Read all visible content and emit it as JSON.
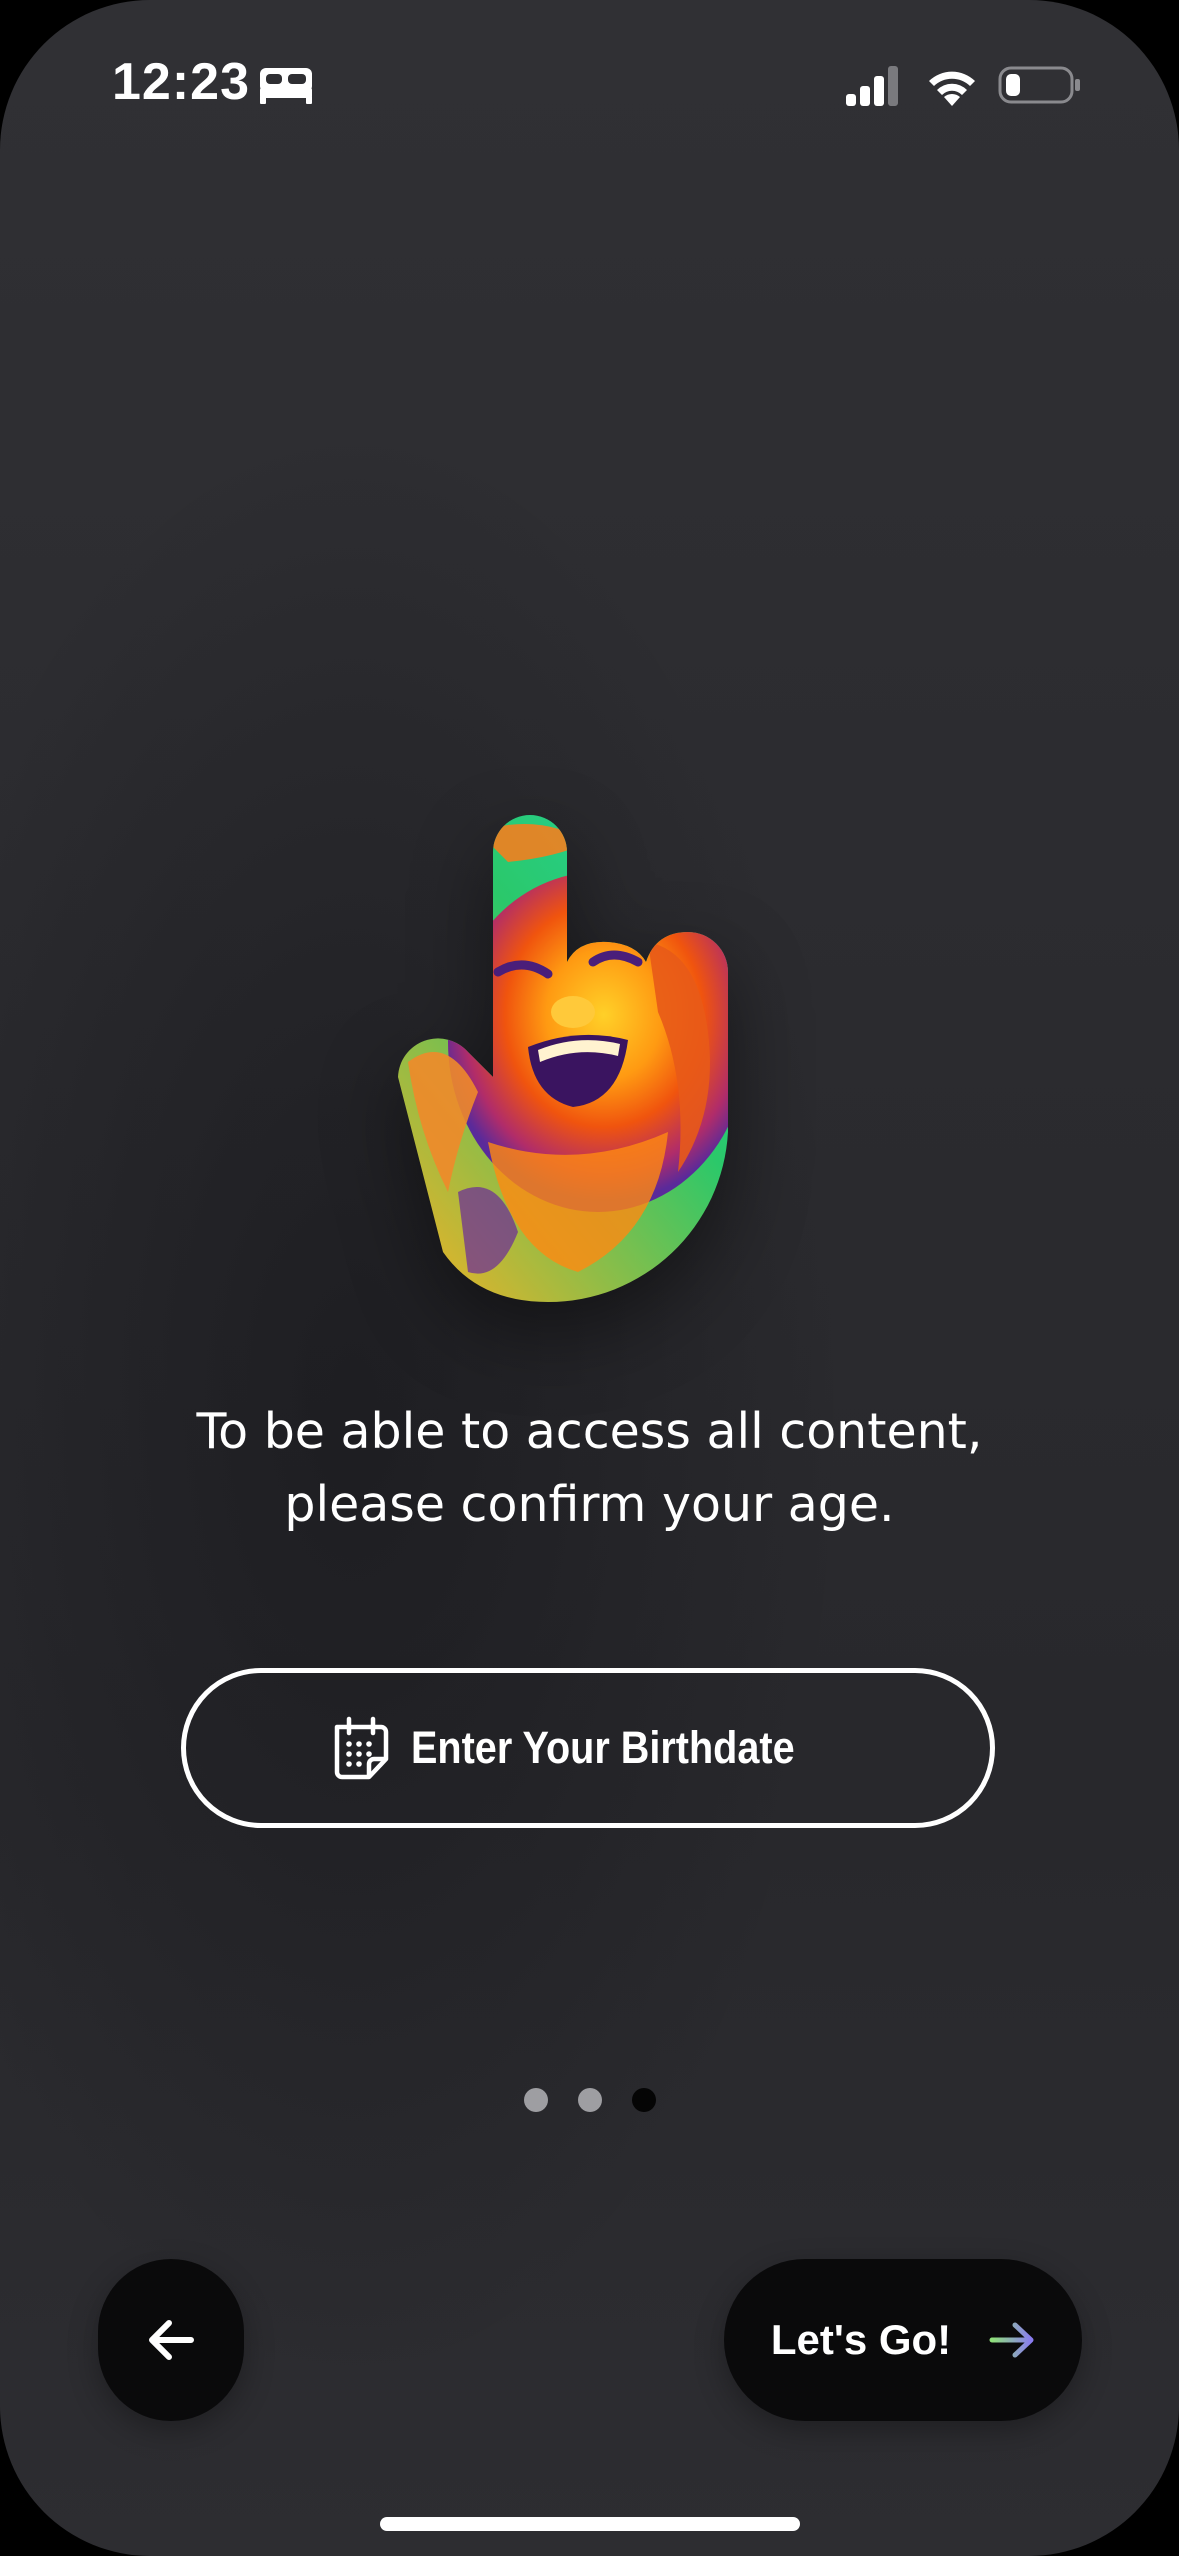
{
  "status_bar": {
    "time": "12:23",
    "icons": [
      "sleep-focus-icon",
      "cellular-signal-icon",
      "wifi-icon",
      "battery-icon"
    ]
  },
  "hero": {
    "icon": "pointing-hand-photo-icon"
  },
  "message": {
    "line1": "To be able to access all content,",
    "line2": "please confirm your age."
  },
  "birthdate_button": {
    "label": "Enter Your Birthdate",
    "icon": "calendar-icon"
  },
  "pager": {
    "total": 3,
    "current": 3
  },
  "navigation": {
    "back_icon": "arrow-left-icon",
    "next_label": "Let's Go!",
    "next_icon": "arrow-right-icon"
  },
  "colors": {
    "background": "#2d2d31",
    "button_dark": "#0a0a0b",
    "text": "#ffffff",
    "dot_inactive": "#9e9ea2",
    "dot_active": "#050505",
    "arrow_gradient_start": "#8fe07a",
    "arrow_gradient_end": "#8a7cf0"
  }
}
